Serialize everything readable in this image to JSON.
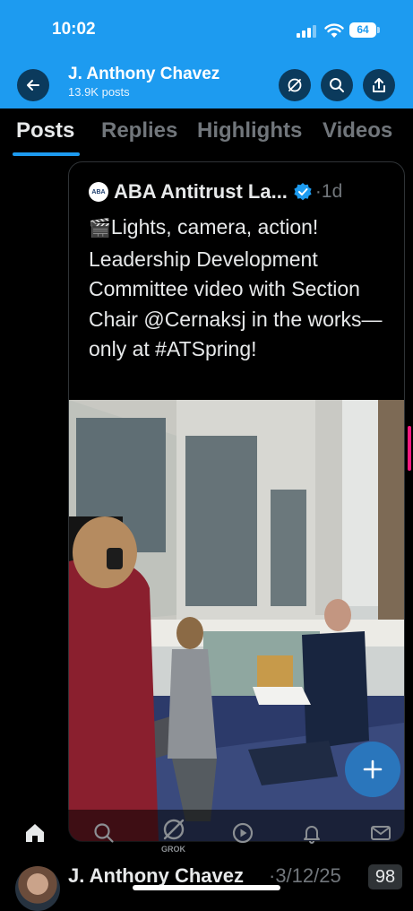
{
  "status_bar": {
    "time": "10:02",
    "battery": "64"
  },
  "profile_header": {
    "name": "J. Anthony Chavez",
    "posts_count": "13.9K posts"
  },
  "tabs": [
    {
      "label": "Posts",
      "active": true
    },
    {
      "label": "Replies",
      "active": false
    },
    {
      "label": "Highlights",
      "active": false
    },
    {
      "label": "Videos",
      "active": false
    }
  ],
  "quoted_post": {
    "avatar_text": "ABA",
    "author": "ABA Antitrust La...",
    "time": "·1d",
    "emoji": "🎬",
    "text": "Lights, camera, action! Leadership Development Committee video with Section Chair @Cernaksj in the works—only at #ATSpring!"
  },
  "bottom_nav": {
    "items": [
      "home-icon",
      "search-icon",
      "grok-icon",
      "video-icon",
      "bell-icon",
      "mail-icon"
    ],
    "grok_label": "GROK"
  },
  "next_post": {
    "author": "J. Anthony Chavez",
    "date": "·3/12/25",
    "badge": "98"
  },
  "colors": {
    "accent": "#1d9bf0",
    "background": "#000000",
    "muted": "#71767b"
  }
}
